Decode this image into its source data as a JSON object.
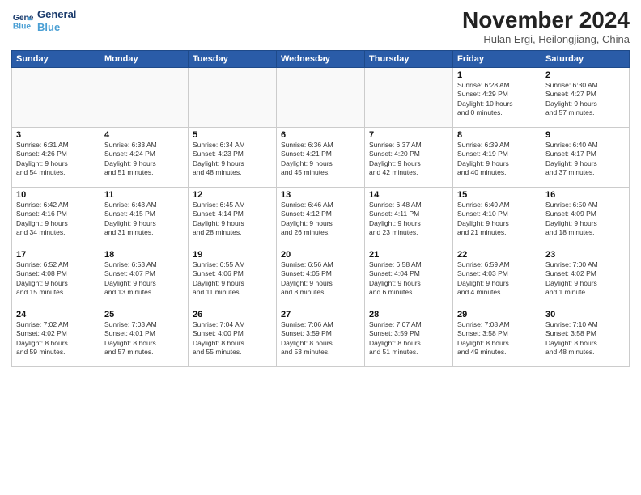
{
  "header": {
    "logo_line1": "General",
    "logo_line2": "Blue",
    "month_title": "November 2024",
    "subtitle": "Hulan Ergi, Heilongjiang, China"
  },
  "weekdays": [
    "Sunday",
    "Monday",
    "Tuesday",
    "Wednesday",
    "Thursday",
    "Friday",
    "Saturday"
  ],
  "weeks": [
    [
      {
        "day": "",
        "info": "",
        "empty": true
      },
      {
        "day": "",
        "info": "",
        "empty": true
      },
      {
        "day": "",
        "info": "",
        "empty": true
      },
      {
        "day": "",
        "info": "",
        "empty": true
      },
      {
        "day": "",
        "info": "",
        "empty": true
      },
      {
        "day": "1",
        "info": "Sunrise: 6:28 AM\nSunset: 4:29 PM\nDaylight: 10 hours\nand 0 minutes.",
        "empty": false
      },
      {
        "day": "2",
        "info": "Sunrise: 6:30 AM\nSunset: 4:27 PM\nDaylight: 9 hours\nand 57 minutes.",
        "empty": false
      }
    ],
    [
      {
        "day": "3",
        "info": "Sunrise: 6:31 AM\nSunset: 4:26 PM\nDaylight: 9 hours\nand 54 minutes.",
        "empty": false
      },
      {
        "day": "4",
        "info": "Sunrise: 6:33 AM\nSunset: 4:24 PM\nDaylight: 9 hours\nand 51 minutes.",
        "empty": false
      },
      {
        "day": "5",
        "info": "Sunrise: 6:34 AM\nSunset: 4:23 PM\nDaylight: 9 hours\nand 48 minutes.",
        "empty": false
      },
      {
        "day": "6",
        "info": "Sunrise: 6:36 AM\nSunset: 4:21 PM\nDaylight: 9 hours\nand 45 minutes.",
        "empty": false
      },
      {
        "day": "7",
        "info": "Sunrise: 6:37 AM\nSunset: 4:20 PM\nDaylight: 9 hours\nand 42 minutes.",
        "empty": false
      },
      {
        "day": "8",
        "info": "Sunrise: 6:39 AM\nSunset: 4:19 PM\nDaylight: 9 hours\nand 40 minutes.",
        "empty": false
      },
      {
        "day": "9",
        "info": "Sunrise: 6:40 AM\nSunset: 4:17 PM\nDaylight: 9 hours\nand 37 minutes.",
        "empty": false
      }
    ],
    [
      {
        "day": "10",
        "info": "Sunrise: 6:42 AM\nSunset: 4:16 PM\nDaylight: 9 hours\nand 34 minutes.",
        "empty": false
      },
      {
        "day": "11",
        "info": "Sunrise: 6:43 AM\nSunset: 4:15 PM\nDaylight: 9 hours\nand 31 minutes.",
        "empty": false
      },
      {
        "day": "12",
        "info": "Sunrise: 6:45 AM\nSunset: 4:14 PM\nDaylight: 9 hours\nand 28 minutes.",
        "empty": false
      },
      {
        "day": "13",
        "info": "Sunrise: 6:46 AM\nSunset: 4:12 PM\nDaylight: 9 hours\nand 26 minutes.",
        "empty": false
      },
      {
        "day": "14",
        "info": "Sunrise: 6:48 AM\nSunset: 4:11 PM\nDaylight: 9 hours\nand 23 minutes.",
        "empty": false
      },
      {
        "day": "15",
        "info": "Sunrise: 6:49 AM\nSunset: 4:10 PM\nDaylight: 9 hours\nand 21 minutes.",
        "empty": false
      },
      {
        "day": "16",
        "info": "Sunrise: 6:50 AM\nSunset: 4:09 PM\nDaylight: 9 hours\nand 18 minutes.",
        "empty": false
      }
    ],
    [
      {
        "day": "17",
        "info": "Sunrise: 6:52 AM\nSunset: 4:08 PM\nDaylight: 9 hours\nand 15 minutes.",
        "empty": false
      },
      {
        "day": "18",
        "info": "Sunrise: 6:53 AM\nSunset: 4:07 PM\nDaylight: 9 hours\nand 13 minutes.",
        "empty": false
      },
      {
        "day": "19",
        "info": "Sunrise: 6:55 AM\nSunset: 4:06 PM\nDaylight: 9 hours\nand 11 minutes.",
        "empty": false
      },
      {
        "day": "20",
        "info": "Sunrise: 6:56 AM\nSunset: 4:05 PM\nDaylight: 9 hours\nand 8 minutes.",
        "empty": false
      },
      {
        "day": "21",
        "info": "Sunrise: 6:58 AM\nSunset: 4:04 PM\nDaylight: 9 hours\nand 6 minutes.",
        "empty": false
      },
      {
        "day": "22",
        "info": "Sunrise: 6:59 AM\nSunset: 4:03 PM\nDaylight: 9 hours\nand 4 minutes.",
        "empty": false
      },
      {
        "day": "23",
        "info": "Sunrise: 7:00 AM\nSunset: 4:02 PM\nDaylight: 9 hours\nand 1 minute.",
        "empty": false
      }
    ],
    [
      {
        "day": "24",
        "info": "Sunrise: 7:02 AM\nSunset: 4:02 PM\nDaylight: 8 hours\nand 59 minutes.",
        "empty": false
      },
      {
        "day": "25",
        "info": "Sunrise: 7:03 AM\nSunset: 4:01 PM\nDaylight: 8 hours\nand 57 minutes.",
        "empty": false
      },
      {
        "day": "26",
        "info": "Sunrise: 7:04 AM\nSunset: 4:00 PM\nDaylight: 8 hours\nand 55 minutes.",
        "empty": false
      },
      {
        "day": "27",
        "info": "Sunrise: 7:06 AM\nSunset: 3:59 PM\nDaylight: 8 hours\nand 53 minutes.",
        "empty": false
      },
      {
        "day": "28",
        "info": "Sunrise: 7:07 AM\nSunset: 3:59 PM\nDaylight: 8 hours\nand 51 minutes.",
        "empty": false
      },
      {
        "day": "29",
        "info": "Sunrise: 7:08 AM\nSunset: 3:58 PM\nDaylight: 8 hours\nand 49 minutes.",
        "empty": false
      },
      {
        "day": "30",
        "info": "Sunrise: 7:10 AM\nSunset: 3:58 PM\nDaylight: 8 hours\nand 48 minutes.",
        "empty": false
      }
    ]
  ]
}
